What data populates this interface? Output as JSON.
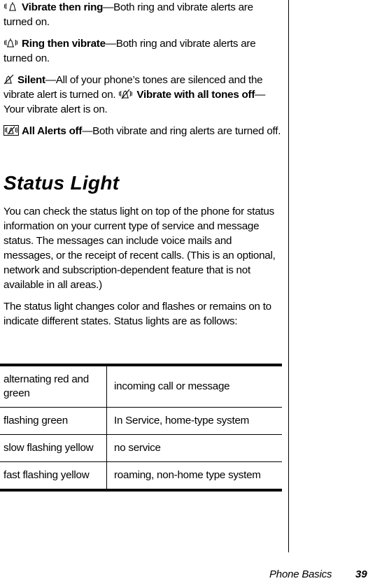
{
  "alerts": [
    {
      "icon": "vibrate-then-ring-icon",
      "title": "Vibrate then ring",
      "text": "—Both ring and vibrate alerts are turned on."
    },
    {
      "icon": "ring-then-vibrate-icon",
      "title": "Ring then vibrate",
      "text": "—Both ring and vibrate alerts are turned on."
    },
    {
      "icon": "silent-icon",
      "title": "Silent",
      "text": "—All of your phone’s tones are silenced and the vibrate alert is turned on.",
      "icon2": "vibrate-all-tones-off-icon",
      "title2": "Vibrate with all tones off",
      "text2": "—Your vibrate alert is on."
    },
    {
      "icon": "all-alerts-off-icon",
      "title": "All Alerts off",
      "text": "—Both vibrate and ring alerts are turned off."
    }
  ],
  "section": {
    "heading": "Status Light",
    "para1": "You can check the status light on top of the phone for status information on your current type of service and message status. The messages can include voice mails and messages, or the receipt of recent calls. (This is an optional, network and subscription-dependent feature that is not available in all areas.)",
    "para2": "The status light changes color and flashes or remains on to indicate different states. Status lights are as follows:"
  },
  "status_table": [
    {
      "light": "alternating red and green",
      "meaning": "incoming call or message"
    },
    {
      "light": "flashing green",
      "meaning": "In Service, home-type system"
    },
    {
      "light": "slow flashing yellow",
      "meaning": "no service"
    },
    {
      "light": "fast flashing yellow",
      "meaning": "roaming, non-home type system"
    }
  ],
  "footer": {
    "section_title": "Phone Basics",
    "page_number": "39"
  }
}
